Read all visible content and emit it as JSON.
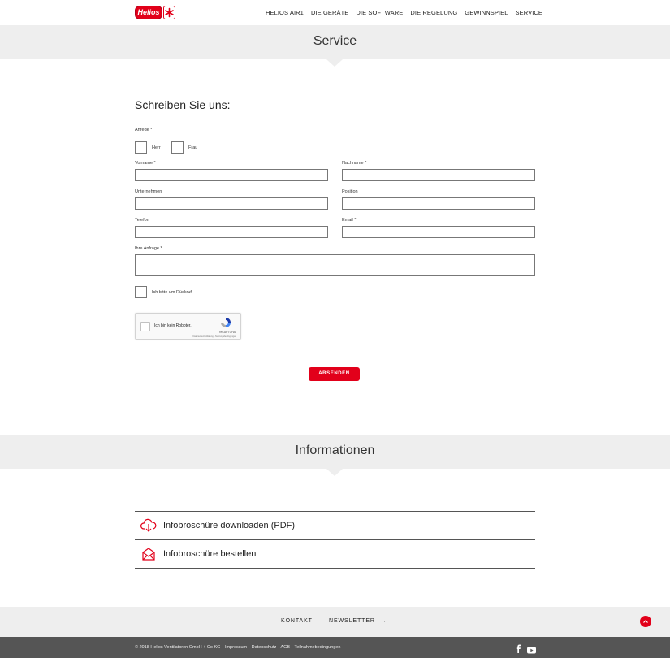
{
  "header": {
    "logo_text": "Helios",
    "nav": [
      "HELIOS AIR1",
      "DIE GERÄTE",
      "DIE SOFTWARE",
      "DIE REGELUNG",
      "GEWINNSPIEL",
      "SERVICE"
    ],
    "active_nav": "SERVICE"
  },
  "service_band": {
    "title": "Service"
  },
  "form": {
    "heading": "Schreiben Sie uns:",
    "anrede_label": "Anrede *",
    "anrede_options": [
      "Herr",
      "Frau"
    ],
    "vorname_label": "Vorname *",
    "vorname_value": "",
    "nachname_label": "Nachname *",
    "nachname_value": "",
    "unternehmen_label": "Unternehmen",
    "unternehmen_value": "",
    "position_label": "Position",
    "position_value": "",
    "telefon_label": "Telefon",
    "telefon_value": "",
    "email_label": "Email *",
    "email_value": "",
    "anfrage_label": "Ihre Anfrage *",
    "anfrage_value": "",
    "rueckruf_label": "Ich bitte um Rückruf",
    "recaptcha_text": "Ich bin kein Roboter.",
    "recaptcha_brand": "reCAPTCHA",
    "recaptcha_fine": "Datenschutzerklärung - Nutzungsbedingungen",
    "submit_label": "ABSENDEN"
  },
  "info_band": {
    "title": "Informationen"
  },
  "info_items": [
    {
      "label": "Infobroschüre downloaden (PDF)",
      "icon": "cloud-download-icon"
    },
    {
      "label": "Infobroschüre bestellen",
      "icon": "envelope-open-icon"
    }
  ],
  "footer": {
    "links": [
      "KONTAKT",
      "NEWSLETTER"
    ],
    "copyright": "© 2018 Helios Ventilatoren GmbH + Co KG",
    "legal_links": [
      "Impressum",
      "Datenschutz",
      "AGB",
      "Teilnahmebedingungen"
    ],
    "social": [
      "facebook-icon",
      "youtube-icon"
    ]
  },
  "colors": {
    "accent": "#e2001a",
    "band": "#eeeeee",
    "footer_dark": "#555555"
  }
}
